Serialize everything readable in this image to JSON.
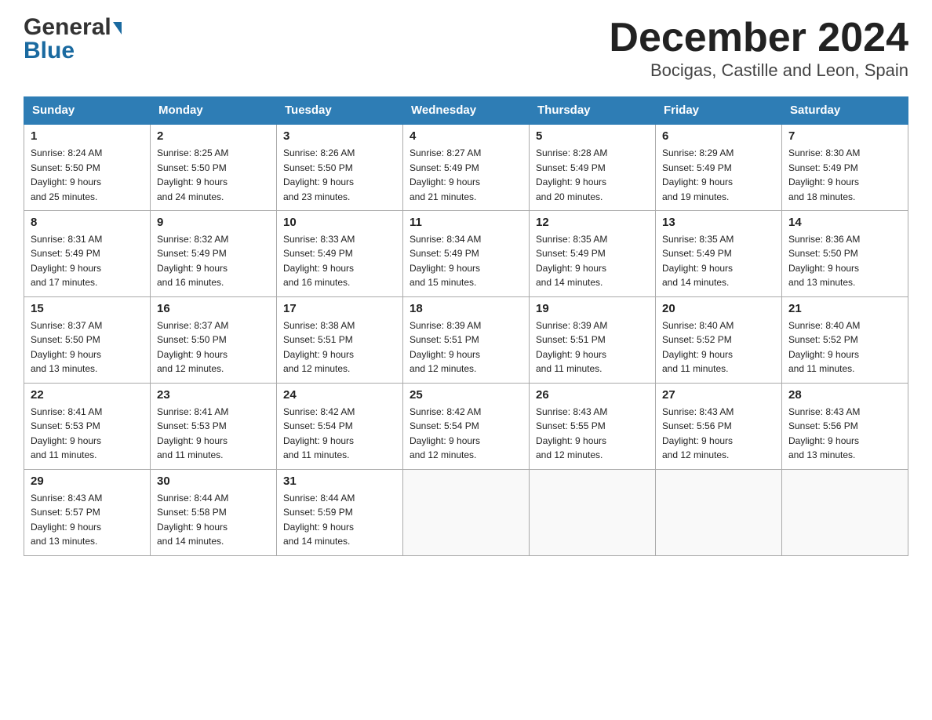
{
  "header": {
    "logo_general": "General",
    "logo_blue": "Blue",
    "month_title": "December 2024",
    "location": "Bocigas, Castille and Leon, Spain"
  },
  "days_of_week": [
    "Sunday",
    "Monday",
    "Tuesday",
    "Wednesday",
    "Thursday",
    "Friday",
    "Saturday"
  ],
  "weeks": [
    [
      {
        "day": "1",
        "sunrise": "8:24 AM",
        "sunset": "5:50 PM",
        "daylight": "9 hours and 25 minutes."
      },
      {
        "day": "2",
        "sunrise": "8:25 AM",
        "sunset": "5:50 PM",
        "daylight": "9 hours and 24 minutes."
      },
      {
        "day": "3",
        "sunrise": "8:26 AM",
        "sunset": "5:50 PM",
        "daylight": "9 hours and 23 minutes."
      },
      {
        "day": "4",
        "sunrise": "8:27 AM",
        "sunset": "5:49 PM",
        "daylight": "9 hours and 21 minutes."
      },
      {
        "day": "5",
        "sunrise": "8:28 AM",
        "sunset": "5:49 PM",
        "daylight": "9 hours and 20 minutes."
      },
      {
        "day": "6",
        "sunrise": "8:29 AM",
        "sunset": "5:49 PM",
        "daylight": "9 hours and 19 minutes."
      },
      {
        "day": "7",
        "sunrise": "8:30 AM",
        "sunset": "5:49 PM",
        "daylight": "9 hours and 18 minutes."
      }
    ],
    [
      {
        "day": "8",
        "sunrise": "8:31 AM",
        "sunset": "5:49 PM",
        "daylight": "9 hours and 17 minutes."
      },
      {
        "day": "9",
        "sunrise": "8:32 AM",
        "sunset": "5:49 PM",
        "daylight": "9 hours and 16 minutes."
      },
      {
        "day": "10",
        "sunrise": "8:33 AM",
        "sunset": "5:49 PM",
        "daylight": "9 hours and 16 minutes."
      },
      {
        "day": "11",
        "sunrise": "8:34 AM",
        "sunset": "5:49 PM",
        "daylight": "9 hours and 15 minutes."
      },
      {
        "day": "12",
        "sunrise": "8:35 AM",
        "sunset": "5:49 PM",
        "daylight": "9 hours and 14 minutes."
      },
      {
        "day": "13",
        "sunrise": "8:35 AM",
        "sunset": "5:49 PM",
        "daylight": "9 hours and 14 minutes."
      },
      {
        "day": "14",
        "sunrise": "8:36 AM",
        "sunset": "5:50 PM",
        "daylight": "9 hours and 13 minutes."
      }
    ],
    [
      {
        "day": "15",
        "sunrise": "8:37 AM",
        "sunset": "5:50 PM",
        "daylight": "9 hours and 13 minutes."
      },
      {
        "day": "16",
        "sunrise": "8:37 AM",
        "sunset": "5:50 PM",
        "daylight": "9 hours and 12 minutes."
      },
      {
        "day": "17",
        "sunrise": "8:38 AM",
        "sunset": "5:51 PM",
        "daylight": "9 hours and 12 minutes."
      },
      {
        "day": "18",
        "sunrise": "8:39 AM",
        "sunset": "5:51 PM",
        "daylight": "9 hours and 12 minutes."
      },
      {
        "day": "19",
        "sunrise": "8:39 AM",
        "sunset": "5:51 PM",
        "daylight": "9 hours and 11 minutes."
      },
      {
        "day": "20",
        "sunrise": "8:40 AM",
        "sunset": "5:52 PM",
        "daylight": "9 hours and 11 minutes."
      },
      {
        "day": "21",
        "sunrise": "8:40 AM",
        "sunset": "5:52 PM",
        "daylight": "9 hours and 11 minutes."
      }
    ],
    [
      {
        "day": "22",
        "sunrise": "8:41 AM",
        "sunset": "5:53 PM",
        "daylight": "9 hours and 11 minutes."
      },
      {
        "day": "23",
        "sunrise": "8:41 AM",
        "sunset": "5:53 PM",
        "daylight": "9 hours and 11 minutes."
      },
      {
        "day": "24",
        "sunrise": "8:42 AM",
        "sunset": "5:54 PM",
        "daylight": "9 hours and 11 minutes."
      },
      {
        "day": "25",
        "sunrise": "8:42 AM",
        "sunset": "5:54 PM",
        "daylight": "9 hours and 12 minutes."
      },
      {
        "day": "26",
        "sunrise": "8:43 AM",
        "sunset": "5:55 PM",
        "daylight": "9 hours and 12 minutes."
      },
      {
        "day": "27",
        "sunrise": "8:43 AM",
        "sunset": "5:56 PM",
        "daylight": "9 hours and 12 minutes."
      },
      {
        "day": "28",
        "sunrise": "8:43 AM",
        "sunset": "5:56 PM",
        "daylight": "9 hours and 13 minutes."
      }
    ],
    [
      {
        "day": "29",
        "sunrise": "8:43 AM",
        "sunset": "5:57 PM",
        "daylight": "9 hours and 13 minutes."
      },
      {
        "day": "30",
        "sunrise": "8:44 AM",
        "sunset": "5:58 PM",
        "daylight": "9 hours and 14 minutes."
      },
      {
        "day": "31",
        "sunrise": "8:44 AM",
        "sunset": "5:59 PM",
        "daylight": "9 hours and 14 minutes."
      },
      null,
      null,
      null,
      null
    ]
  ],
  "labels": {
    "sunrise": "Sunrise:",
    "sunset": "Sunset:",
    "daylight": "Daylight:"
  }
}
